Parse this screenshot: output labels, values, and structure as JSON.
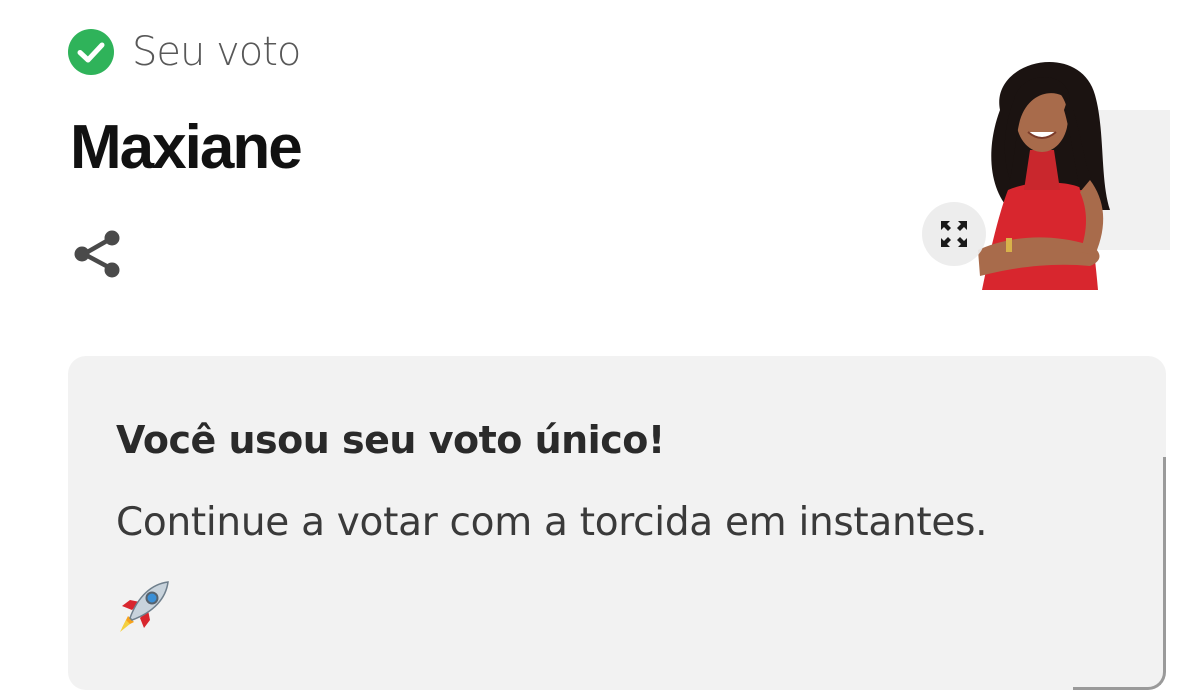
{
  "vote_status": {
    "label": "Seu voto",
    "icon": "check-circle-icon",
    "icon_color": "#2fb35a"
  },
  "candidate": {
    "name": "Maxiane",
    "photo": "candidate-photo",
    "photo_dress_color": "#d8262e"
  },
  "actions": {
    "share_icon": "share-icon",
    "expand_icon": "expand-icon"
  },
  "message_card": {
    "title": "Você usou seu voto único!",
    "text": "Continue a votar com a torcida em instantes.",
    "emoji": "rocket-icon",
    "background": "#f2f2f2"
  }
}
